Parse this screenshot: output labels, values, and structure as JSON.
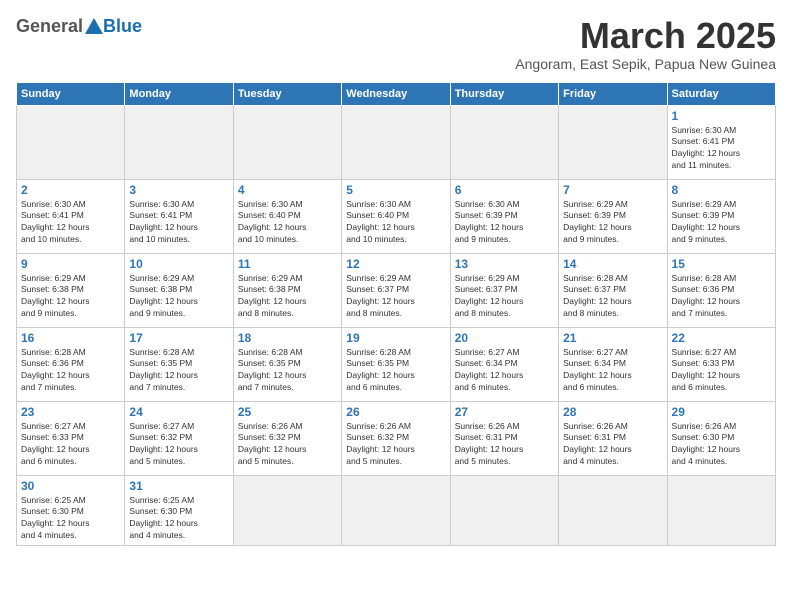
{
  "header": {
    "logo_general": "General",
    "logo_blue": "Blue",
    "month_title": "March 2025",
    "subtitle": "Angoram, East Sepik, Papua New Guinea"
  },
  "weekdays": [
    "Sunday",
    "Monday",
    "Tuesday",
    "Wednesday",
    "Thursday",
    "Friday",
    "Saturday"
  ],
  "days": {
    "d1": {
      "num": "1",
      "info": "Sunrise: 6:30 AM\nSunset: 6:41 PM\nDaylight: 12 hours\nand 11 minutes."
    },
    "d2": {
      "num": "2",
      "info": "Sunrise: 6:30 AM\nSunset: 6:41 PM\nDaylight: 12 hours\nand 10 minutes."
    },
    "d3": {
      "num": "3",
      "info": "Sunrise: 6:30 AM\nSunset: 6:41 PM\nDaylight: 12 hours\nand 10 minutes."
    },
    "d4": {
      "num": "4",
      "info": "Sunrise: 6:30 AM\nSunset: 6:40 PM\nDaylight: 12 hours\nand 10 minutes."
    },
    "d5": {
      "num": "5",
      "info": "Sunrise: 6:30 AM\nSunset: 6:40 PM\nDaylight: 12 hours\nand 10 minutes."
    },
    "d6": {
      "num": "6",
      "info": "Sunrise: 6:30 AM\nSunset: 6:39 PM\nDaylight: 12 hours\nand 9 minutes."
    },
    "d7": {
      "num": "7",
      "info": "Sunrise: 6:29 AM\nSunset: 6:39 PM\nDaylight: 12 hours\nand 9 minutes."
    },
    "d8": {
      "num": "8",
      "info": "Sunrise: 6:29 AM\nSunset: 6:39 PM\nDaylight: 12 hours\nand 9 minutes."
    },
    "d9": {
      "num": "9",
      "info": "Sunrise: 6:29 AM\nSunset: 6:38 PM\nDaylight: 12 hours\nand 9 minutes."
    },
    "d10": {
      "num": "10",
      "info": "Sunrise: 6:29 AM\nSunset: 6:38 PM\nDaylight: 12 hours\nand 9 minutes."
    },
    "d11": {
      "num": "11",
      "info": "Sunrise: 6:29 AM\nSunset: 6:38 PM\nDaylight: 12 hours\nand 8 minutes."
    },
    "d12": {
      "num": "12",
      "info": "Sunrise: 6:29 AM\nSunset: 6:37 PM\nDaylight: 12 hours\nand 8 minutes."
    },
    "d13": {
      "num": "13",
      "info": "Sunrise: 6:29 AM\nSunset: 6:37 PM\nDaylight: 12 hours\nand 8 minutes."
    },
    "d14": {
      "num": "14",
      "info": "Sunrise: 6:28 AM\nSunset: 6:37 PM\nDaylight: 12 hours\nand 8 minutes."
    },
    "d15": {
      "num": "15",
      "info": "Sunrise: 6:28 AM\nSunset: 6:36 PM\nDaylight: 12 hours\nand 7 minutes."
    },
    "d16": {
      "num": "16",
      "info": "Sunrise: 6:28 AM\nSunset: 6:36 PM\nDaylight: 12 hours\nand 7 minutes."
    },
    "d17": {
      "num": "17",
      "info": "Sunrise: 6:28 AM\nSunset: 6:35 PM\nDaylight: 12 hours\nand 7 minutes."
    },
    "d18": {
      "num": "18",
      "info": "Sunrise: 6:28 AM\nSunset: 6:35 PM\nDaylight: 12 hours\nand 7 minutes."
    },
    "d19": {
      "num": "19",
      "info": "Sunrise: 6:28 AM\nSunset: 6:35 PM\nDaylight: 12 hours\nand 6 minutes."
    },
    "d20": {
      "num": "20",
      "info": "Sunrise: 6:27 AM\nSunset: 6:34 PM\nDaylight: 12 hours\nand 6 minutes."
    },
    "d21": {
      "num": "21",
      "info": "Sunrise: 6:27 AM\nSunset: 6:34 PM\nDaylight: 12 hours\nand 6 minutes."
    },
    "d22": {
      "num": "22",
      "info": "Sunrise: 6:27 AM\nSunset: 6:33 PM\nDaylight: 12 hours\nand 6 minutes."
    },
    "d23": {
      "num": "23",
      "info": "Sunrise: 6:27 AM\nSunset: 6:33 PM\nDaylight: 12 hours\nand 6 minutes."
    },
    "d24": {
      "num": "24",
      "info": "Sunrise: 6:27 AM\nSunset: 6:32 PM\nDaylight: 12 hours\nand 5 minutes."
    },
    "d25": {
      "num": "25",
      "info": "Sunrise: 6:26 AM\nSunset: 6:32 PM\nDaylight: 12 hours\nand 5 minutes."
    },
    "d26": {
      "num": "26",
      "info": "Sunrise: 6:26 AM\nSunset: 6:32 PM\nDaylight: 12 hours\nand 5 minutes."
    },
    "d27": {
      "num": "27",
      "info": "Sunrise: 6:26 AM\nSunset: 6:31 PM\nDaylight: 12 hours\nand 5 minutes."
    },
    "d28": {
      "num": "28",
      "info": "Sunrise: 6:26 AM\nSunset: 6:31 PM\nDaylight: 12 hours\nand 4 minutes."
    },
    "d29": {
      "num": "29",
      "info": "Sunrise: 6:26 AM\nSunset: 6:30 PM\nDaylight: 12 hours\nand 4 minutes."
    },
    "d30": {
      "num": "30",
      "info": "Sunrise: 6:25 AM\nSunset: 6:30 PM\nDaylight: 12 hours\nand 4 minutes."
    },
    "d31": {
      "num": "31",
      "info": "Sunrise: 6:25 AM\nSunset: 6:30 PM\nDaylight: 12 hours\nand 4 minutes."
    }
  }
}
